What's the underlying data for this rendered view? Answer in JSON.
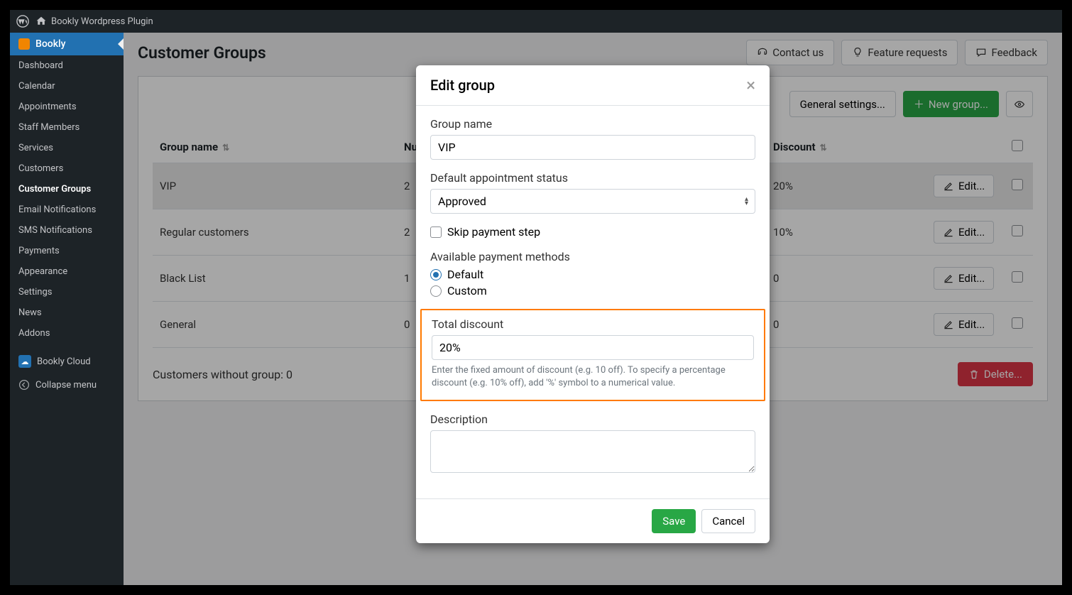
{
  "adminbar": {
    "site_name": "Bookly Wordpress Plugin"
  },
  "sidebar": {
    "top": "Bookly",
    "items": [
      "Dashboard",
      "Calendar",
      "Appointments",
      "Staff Members",
      "Services",
      "Customers",
      "Customer Groups",
      "Email Notifications",
      "SMS Notifications",
      "Payments",
      "Appearance",
      "Settings",
      "News",
      "Addons"
    ],
    "active_index": 6,
    "cloud": "Bookly Cloud",
    "collapse": "Collapse menu"
  },
  "header": {
    "title": "Customer Groups",
    "buttons": {
      "contact": "Contact us",
      "feature": "Feature requests",
      "feedback": "Feedback"
    }
  },
  "panel": {
    "general_settings": "General settings...",
    "new_group": "New group...",
    "columns": {
      "name": "Group name",
      "number": "Number",
      "discount": "Discount"
    },
    "rows": [
      {
        "name": "VIP",
        "number": "2",
        "discount": "20%"
      },
      {
        "name": "Regular customers",
        "number": "2",
        "discount": "10%"
      },
      {
        "name": "Black List",
        "number": "1",
        "discount": "0"
      },
      {
        "name": "General",
        "number": "0",
        "discount": "0"
      }
    ],
    "edit_label": "Edit...",
    "footer_text": "Customers without group: 0",
    "delete_label": "Delete..."
  },
  "modal": {
    "title": "Edit group",
    "group_name_label": "Group name",
    "group_name_value": "VIP",
    "status_label": "Default appointment status",
    "status_value": "Approved",
    "skip_label": "Skip payment step",
    "payment_label": "Available payment methods",
    "payment_default": "Default",
    "payment_custom": "Custom",
    "discount_label": "Total discount",
    "discount_value": "20%",
    "discount_help": "Enter the fixed amount of discount (e.g. 10 off). To specify a percentage discount (e.g. 10% off), add '%' symbol to a numerical value.",
    "description_label": "Description",
    "save": "Save",
    "cancel": "Cancel"
  }
}
